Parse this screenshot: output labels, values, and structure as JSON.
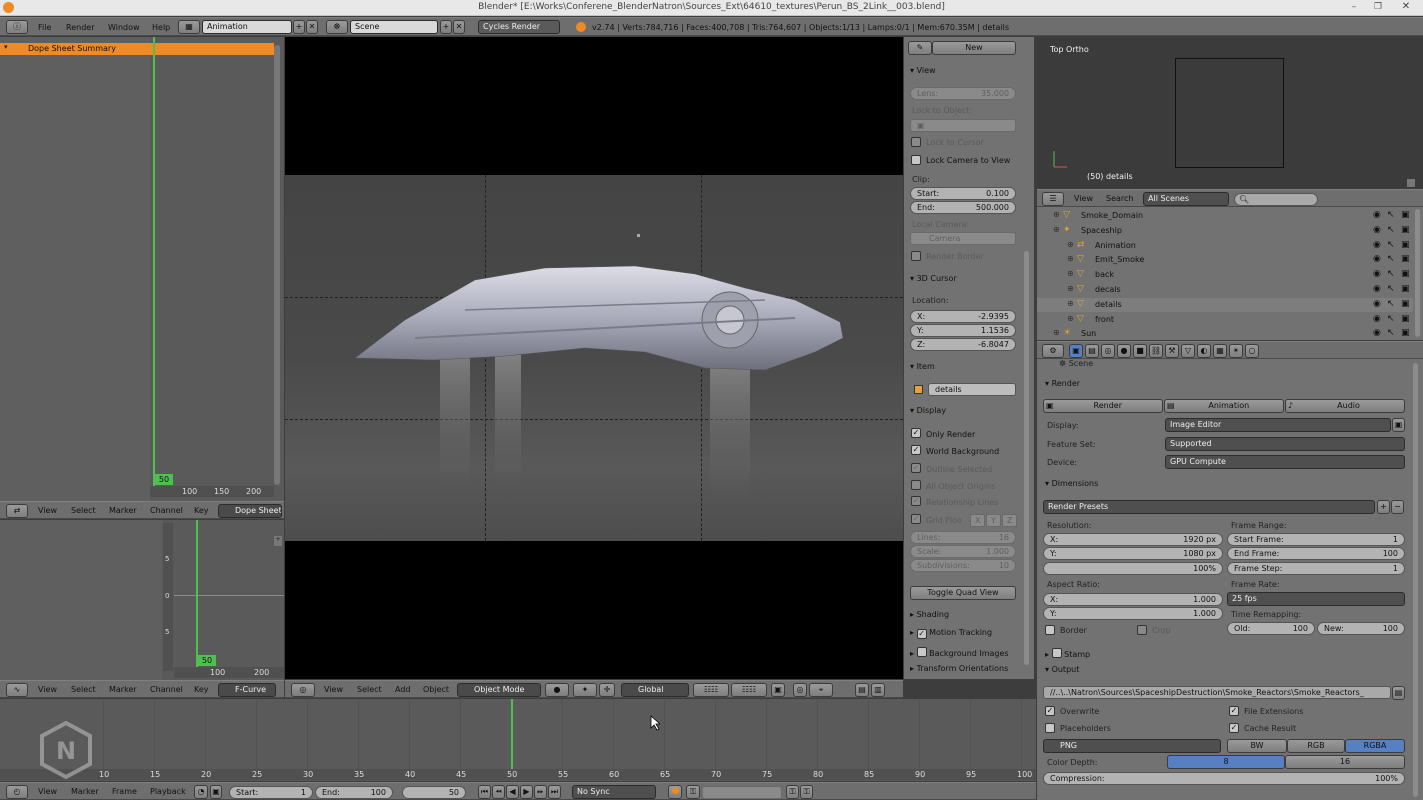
{
  "titlebar": {
    "title": "Blender* [E:\\Works\\Conferene_BlenderNatron\\Sources_Ext\\64610_textures\\Perun_BS_2Link__003.blend]"
  },
  "info_header": {
    "menus": [
      "File",
      "Render",
      "Window",
      "Help"
    ],
    "screen_layout": "Animation",
    "scene": "Scene",
    "engine": "Cycles Render",
    "stats": "v2.74 | Verts:784,716 | Faces:400,708 | Tris:764,607 | Objects:1/13 | Lamps:0/1 | Mem:670.35M | details"
  },
  "dopesheet": {
    "channel": "Dope Sheet Summary",
    "current_frame": "50",
    "ruler": [
      "100",
      "150",
      "200"
    ],
    "menus": [
      "View",
      "Select",
      "Marker",
      "Channel",
      "Key"
    ],
    "mode": "Dope Sheet"
  },
  "graph_editor": {
    "current_frame": "50",
    "ruler": [
      "100",
      "200"
    ],
    "menus": [
      "View",
      "Select",
      "Marker",
      "Channel",
      "Key"
    ],
    "mode": "F-Curve",
    "yticks": [
      "5",
      "0",
      "5"
    ]
  },
  "viewport": {
    "menus": [
      "View",
      "Select",
      "Add",
      "Object"
    ],
    "mode": "Object Mode",
    "orientation": "Global"
  },
  "npanel": {
    "new_label": "New",
    "view_header": "View",
    "lens_label": "Lens:",
    "lens_value": "35.000",
    "lock_object_label": "Lock to Object:",
    "lock_cursor_label": "Lock to Cursor",
    "lock_camera_label": "Lock Camera to View",
    "clip_label": "Clip:",
    "clip_start_label": "Start:",
    "clip_start_value": "0.100",
    "clip_end_label": "End:",
    "clip_end_value": "500.000",
    "local_camera_label": "Local Camera:",
    "local_camera_value": "Camera",
    "render_border_label": "Render Border",
    "cursor_header": "3D Cursor",
    "location_label": "Location:",
    "x_label": "X:",
    "x_value": "-2.9395",
    "y_label": "Y:",
    "y_value": "1.1536",
    "z_label": "Z:",
    "z_value": "-6.8047",
    "item_header": "Item",
    "item_name": "details",
    "display_header": "Display",
    "only_render": "Only Render",
    "world_background": "World Background",
    "outline_selected": "Outline Selected",
    "all_origins": "All Object Origins",
    "relationship_lines": "Relationship Lines",
    "grid_floor": "Grid Floo",
    "grid_axes": [
      "X",
      "Y",
      "Z"
    ],
    "lines_label": "Lines:",
    "lines_value": "16",
    "scale_label": "Scale:",
    "scale_value": "1.000",
    "subdiv_label": "Subdivisions:",
    "subdiv_value": "10",
    "toggle_quad": "Toggle Quad View",
    "shading": "Shading",
    "motion_tracking": "Motion Tracking",
    "background_images": "Background Images",
    "transform_orientations": "Transform Orientations"
  },
  "top_ortho": {
    "label": "Top Ortho",
    "object": "(50) details"
  },
  "outliner": {
    "menus": [
      "View",
      "Search"
    ],
    "filter": "All Scenes",
    "items": [
      {
        "name": "Smoke_Domain",
        "depth": 1
      },
      {
        "name": "Spaceship",
        "depth": 1
      },
      {
        "name": "Animation",
        "depth": 2
      },
      {
        "name": "Emit_Smoke",
        "depth": 2
      },
      {
        "name": "back",
        "depth": 2
      },
      {
        "name": "decals",
        "depth": 2
      },
      {
        "name": "details",
        "depth": 2
      },
      {
        "name": "front",
        "depth": 2
      },
      {
        "name": "Sun",
        "depth": 1
      }
    ]
  },
  "properties": {
    "breadcrumb": "Scene",
    "render_header": "Render",
    "render_btn": "Render",
    "animation_btn": "Animation",
    "audio_btn": "Audio",
    "display_label": "Display:",
    "display_value": "Image Editor",
    "feature_label": "Feature Set:",
    "feature_value": "Supported",
    "device_label": "Device:",
    "device_value": "GPU Compute",
    "dimensions_header": "Dimensions",
    "presets": "Render Presets",
    "resolution_label": "Resolution:",
    "res_x_label": "X:",
    "res_x": "1920 px",
    "res_y_label": "Y:",
    "res_y": "1080 px",
    "res_pct": "100%",
    "frame_range_label": "Frame Range:",
    "start_frame_label": "Start Frame:",
    "start_frame": "1",
    "end_frame_label": "End Frame:",
    "end_frame": "100",
    "frame_step_label": "Frame Step:",
    "frame_step": "1",
    "aspect_label": "Aspect Ratio:",
    "aspect_x_label": "X:",
    "aspect_x": "1.000",
    "aspect_y_label": "Y:",
    "aspect_y": "1.000",
    "frame_rate_label": "Frame Rate:",
    "frame_rate": "25 fps",
    "time_remap_label": "Time Remapping:",
    "old_label": "Old:",
    "old_value": "100",
    "new_label": "New:",
    "new_value": "100",
    "border_label": "Border",
    "crop_label": "Crop",
    "stamp_header": "Stamp",
    "output_header": "Output",
    "output_path": "//..\\..\\Natron\\Sources\\SpaceshipDestruction\\Smoke_Reactors\\Smoke_Reactors_",
    "overwrite": "Overwrite",
    "file_extensions": "File Extensions",
    "placeholders": "Placeholders",
    "cache_result": "Cache Result",
    "format": "PNG",
    "bw": "BW",
    "rgb": "RGB",
    "rgba": "RGBA",
    "color_depth_label": "Color Depth:",
    "depth_8": "8",
    "depth_16": "16",
    "compression_label": "Compression:",
    "compression_value": "100%"
  },
  "timeline": {
    "ruler": [
      "10",
      "15",
      "20",
      "25",
      "30",
      "35",
      "40",
      "45",
      "50",
      "55",
      "60",
      "65",
      "70",
      "75",
      "80",
      "85",
      "90",
      "95",
      "100"
    ],
    "menus": [
      "View",
      "Marker",
      "Frame",
      "Playback"
    ],
    "start_label": "Start:",
    "start_value": "1",
    "end_label": "End:",
    "end_value": "100",
    "current": "50",
    "sync": "No Sync"
  },
  "colors": {
    "accent_orange": "#f08a24",
    "frame_green": "#4fc04f",
    "selection_blue": "#5680c2"
  }
}
